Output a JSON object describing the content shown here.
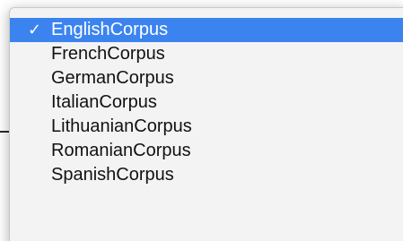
{
  "menu": {
    "items": [
      {
        "label": "EnglishCorpus",
        "selected": true,
        "check": "✓"
      },
      {
        "label": "FrenchCorpus",
        "selected": false
      },
      {
        "label": "GermanCorpus",
        "selected": false
      },
      {
        "label": "ItalianCorpus",
        "selected": false
      },
      {
        "label": "LithuanianCorpus",
        "selected": false
      },
      {
        "label": "RomanianCorpus",
        "selected": false
      },
      {
        "label": "SpanishCorpus",
        "selected": false
      }
    ]
  },
  "colors": {
    "selection": "#3b84f0",
    "menu_background": "#f3f3f3",
    "text": "#111111",
    "button": "#5a8fe8"
  }
}
